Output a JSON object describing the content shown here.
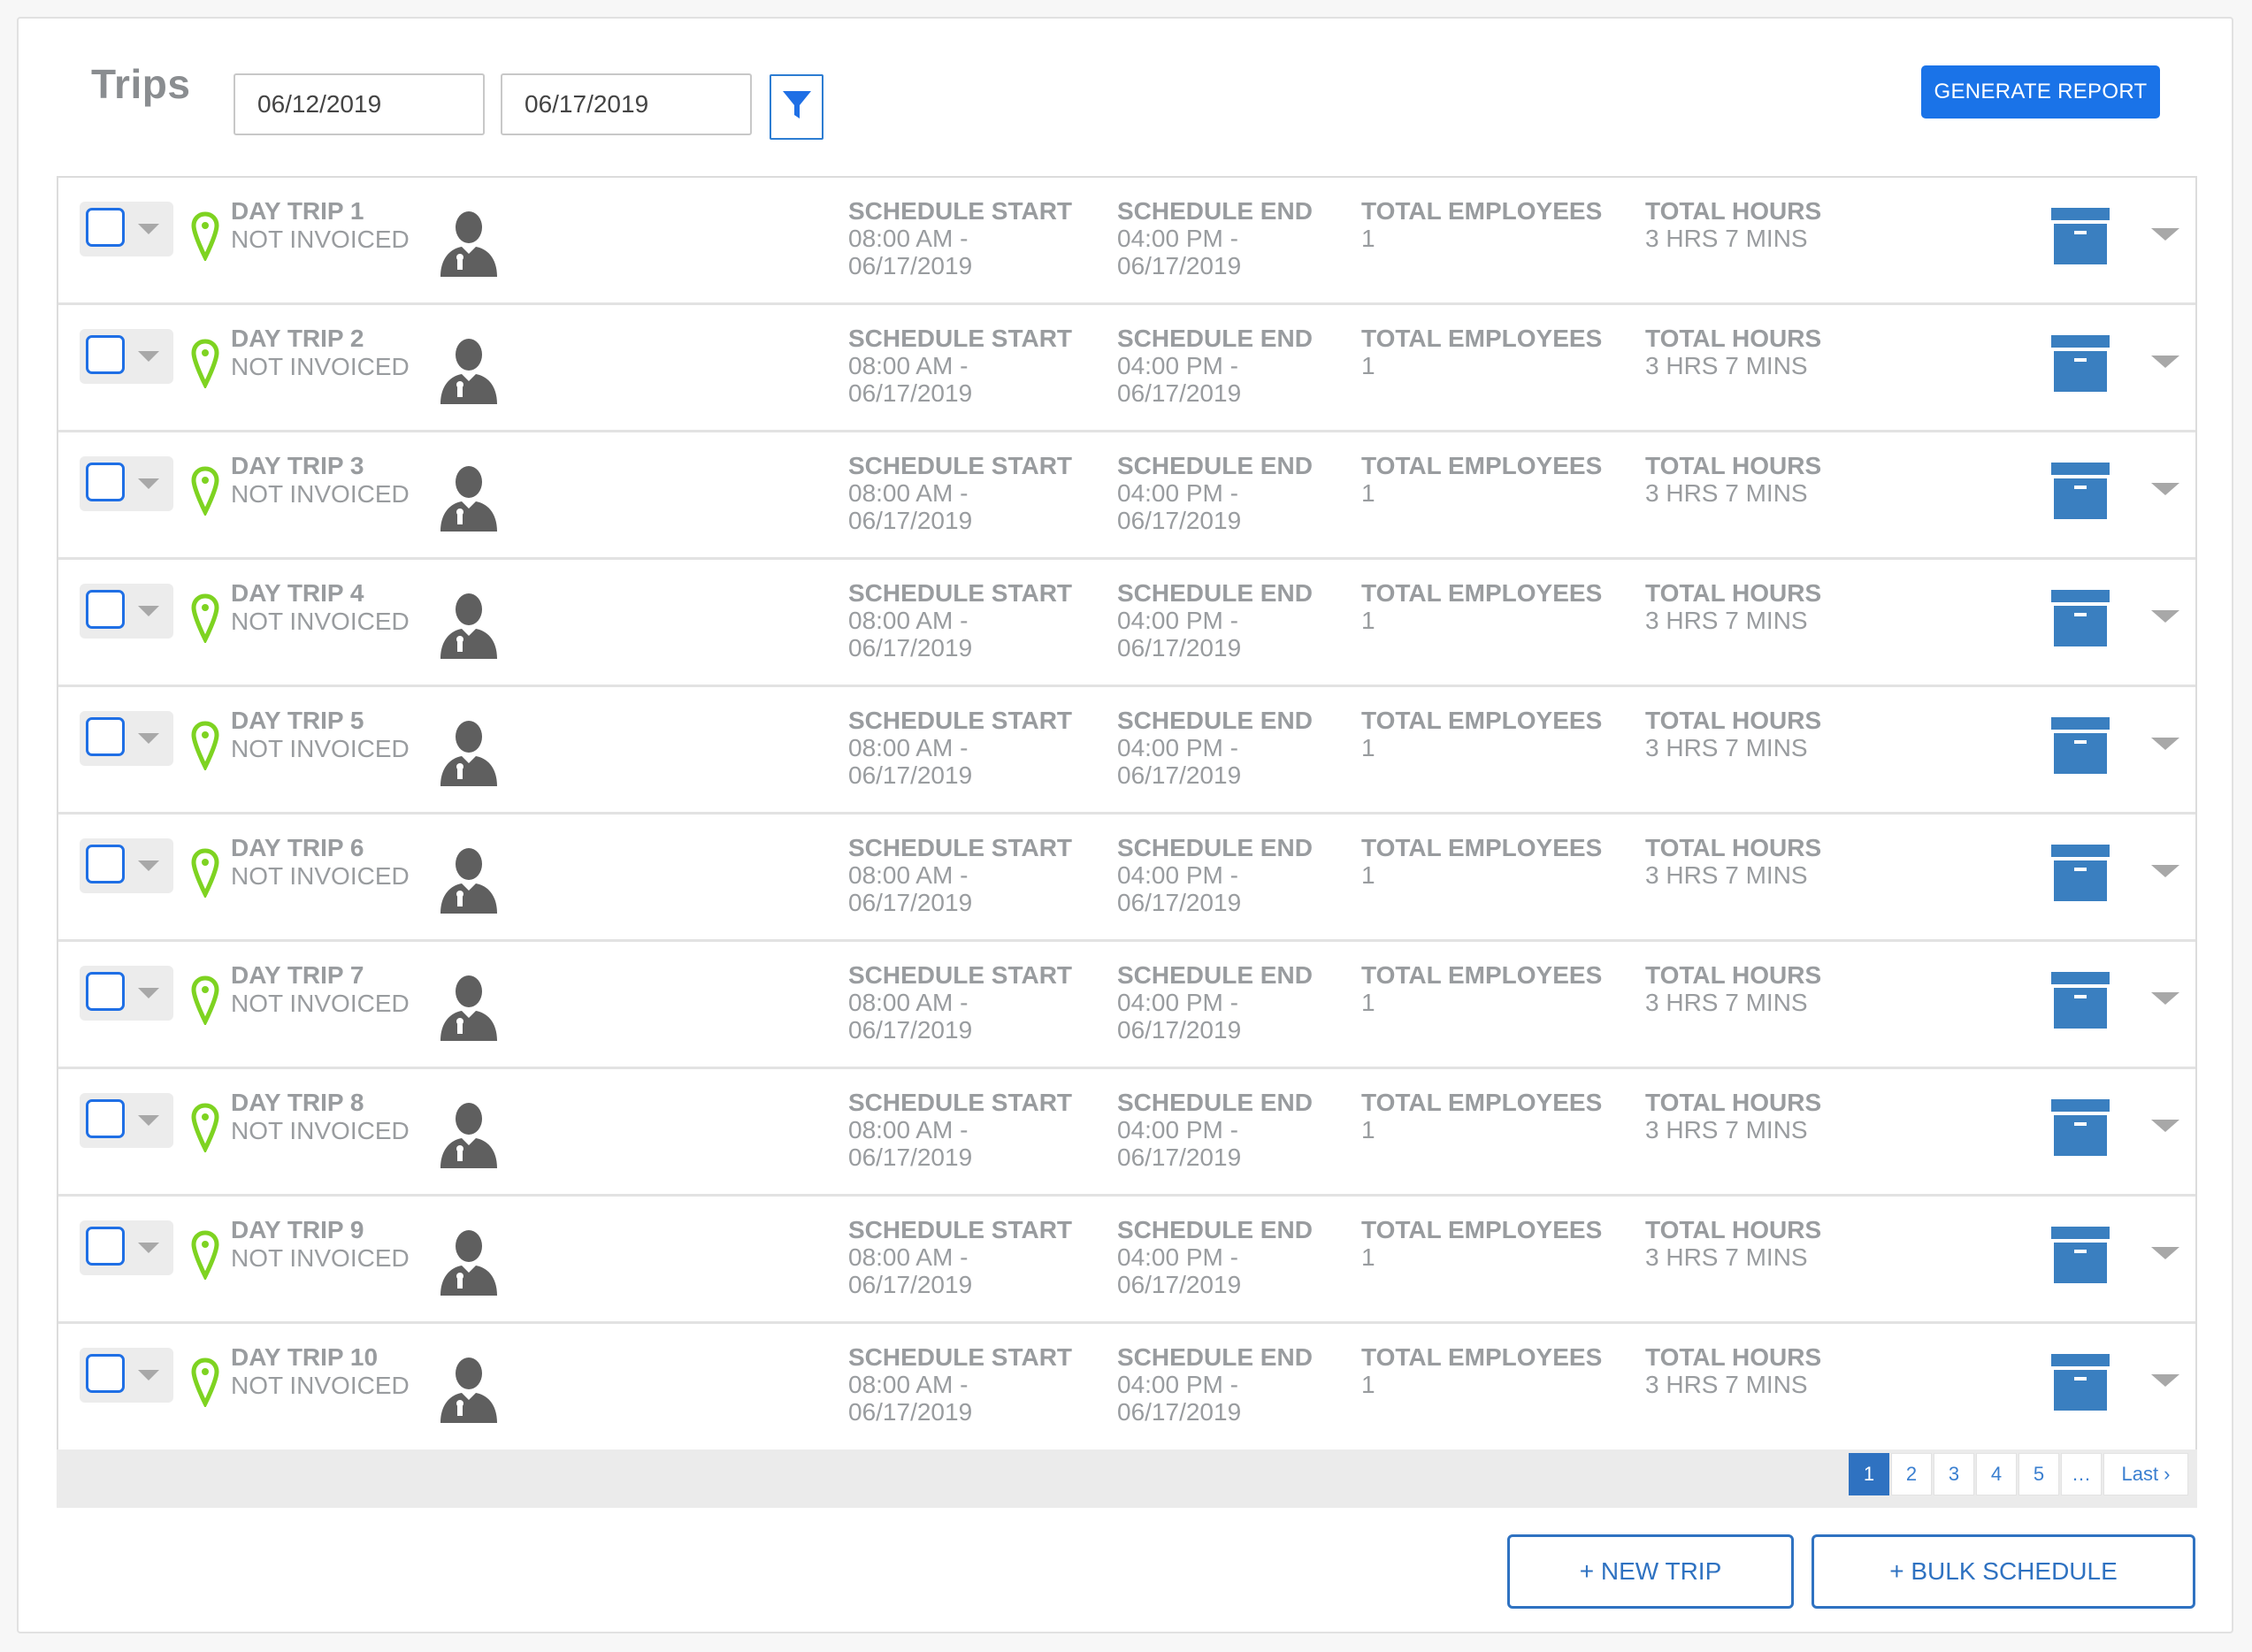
{
  "header": {
    "title": "Trips",
    "start_date": "06/12/2019",
    "end_date": "06/17/2019",
    "filter_icon": "filter-icon",
    "generate_report_label": "GENERATE REPORT"
  },
  "colors": {
    "primary": "#1a73e8",
    "pin": "#7ed321",
    "archive": "#3a7fc0",
    "text_muted": "#999c9f"
  },
  "column_headers": {
    "schedule_start": "SCHEDULE START",
    "schedule_end": "SCHEDULE END",
    "total_employees": "TOTAL EMPLOYEES",
    "total_hours": "TOTAL HOURS"
  },
  "trips": [
    {
      "name": "DAY TRIP 1",
      "status": "NOT INVOICED",
      "start_time": "08:00 AM -",
      "start_date": "06/17/2019",
      "end_time": "04:00 PM -",
      "end_date": "06/17/2019",
      "employees": "1",
      "hours": "3 HRS 7 MINS"
    },
    {
      "name": "DAY TRIP 2",
      "status": "NOT INVOICED",
      "start_time": "08:00 AM -",
      "start_date": "06/17/2019",
      "end_time": "04:00 PM -",
      "end_date": "06/17/2019",
      "employees": "1",
      "hours": "3 HRS 7 MINS"
    },
    {
      "name": "DAY TRIP 3",
      "status": "NOT INVOICED",
      "start_time": "08:00 AM -",
      "start_date": "06/17/2019",
      "end_time": "04:00 PM -",
      "end_date": "06/17/2019",
      "employees": "1",
      "hours": "3 HRS 7 MINS"
    },
    {
      "name": "DAY TRIP 4",
      "status": "NOT INVOICED",
      "start_time": "08:00 AM -",
      "start_date": "06/17/2019",
      "end_time": "04:00 PM -",
      "end_date": "06/17/2019",
      "employees": "1",
      "hours": "3 HRS 7 MINS"
    },
    {
      "name": "DAY TRIP 5",
      "status": "NOT INVOICED",
      "start_time": "08:00 AM -",
      "start_date": "06/17/2019",
      "end_time": "04:00 PM -",
      "end_date": "06/17/2019",
      "employees": "1",
      "hours": "3 HRS 7 MINS"
    },
    {
      "name": "DAY TRIP 6",
      "status": "NOT INVOICED",
      "start_time": "08:00 AM -",
      "start_date": "06/17/2019",
      "end_time": "04:00 PM -",
      "end_date": "06/17/2019",
      "employees": "1",
      "hours": "3 HRS 7 MINS"
    },
    {
      "name": "DAY TRIP 7",
      "status": "NOT INVOICED",
      "start_time": "08:00 AM -",
      "start_date": "06/17/2019",
      "end_time": "04:00 PM -",
      "end_date": "06/17/2019",
      "employees": "1",
      "hours": "3 HRS 7 MINS"
    },
    {
      "name": "DAY TRIP 8",
      "status": "NOT INVOICED",
      "start_time": "08:00 AM -",
      "start_date": "06/17/2019",
      "end_time": "04:00 PM -",
      "end_date": "06/17/2019",
      "employees": "1",
      "hours": "3 HRS 7 MINS"
    },
    {
      "name": "DAY TRIP 9",
      "status": "NOT INVOICED",
      "start_time": "08:00 AM -",
      "start_date": "06/17/2019",
      "end_time": "04:00 PM -",
      "end_date": "06/17/2019",
      "employees": "1",
      "hours": "3 HRS 7 MINS"
    },
    {
      "name": "DAY TRIP 10",
      "status": "NOT INVOICED",
      "start_time": "08:00 AM -",
      "start_date": "06/17/2019",
      "end_time": "04:00 PM -",
      "end_date": "06/17/2019",
      "employees": "1",
      "hours": "3 HRS 7 MINS"
    }
  ],
  "pagination": {
    "pages": [
      "1",
      "2",
      "3",
      "4",
      "5",
      "…"
    ],
    "current": "1",
    "last_label": "Last ›"
  },
  "actions": {
    "new_trip_label": "+ NEW TRIP",
    "bulk_schedule_label": "+ BULK SCHEDULE"
  }
}
